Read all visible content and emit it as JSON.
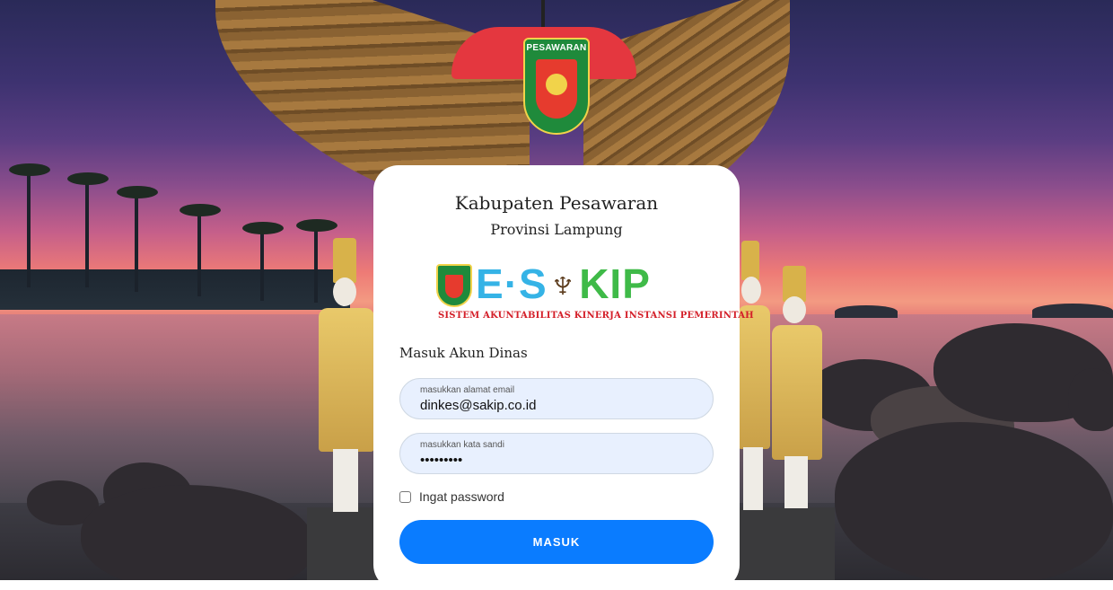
{
  "header": {
    "regency": "Kabupaten Pesawaran",
    "province": "Provinsi Lampung",
    "crest_text": "PESAWARAN"
  },
  "logo": {
    "shield_text": "PESAWARAN",
    "brand_e": "E",
    "brand_dot": "·",
    "brand_s": "S",
    "brand_kip": "KIP",
    "tagline": "SISTEM AKUNTABILITAS KINERJA INSTANSI PEMERINTAH"
  },
  "login": {
    "section_title": "Masuk Akun Dinas",
    "email": {
      "label": "masukkan alamat email",
      "value": "dinkes@sakip.co.id"
    },
    "password": {
      "label": "masukkan kata sandi",
      "value": "•••••••••"
    },
    "remember_label": "Ingat password",
    "remember_checked": false,
    "submit_label": "MASUK"
  },
  "colors": {
    "primary_button": "#0a7cff",
    "input_bg": "#e8f0fe",
    "logo_blue": "#35b3e6",
    "logo_green": "#3fba48",
    "logo_red": "#d4202a"
  }
}
